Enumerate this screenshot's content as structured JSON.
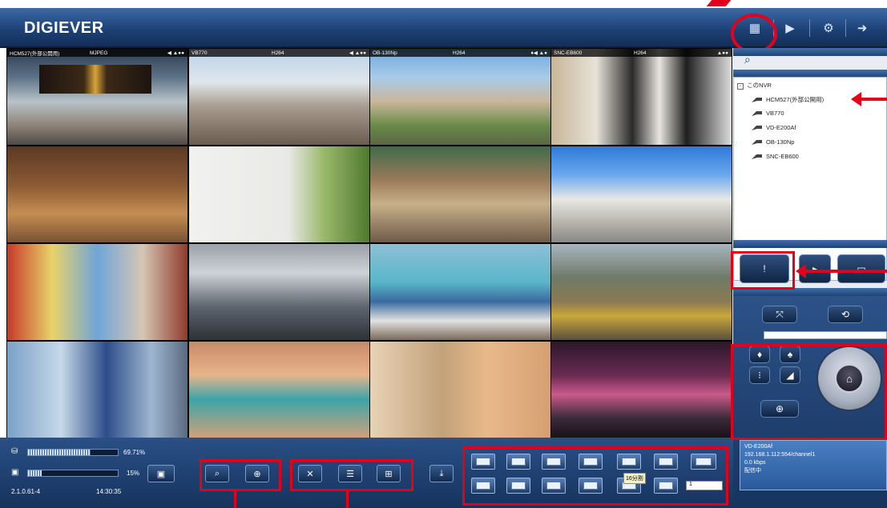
{
  "header": {
    "logo": "DIGIEVER",
    "icons": [
      "layout-icon",
      "playback-icon",
      "settings-icon",
      "logout-icon"
    ]
  },
  "cameras": [
    {
      "name": "HCM527(外部公開用)",
      "codec": "MJPEG",
      "icons": "◀ ▲●●"
    },
    {
      "name": "VB770",
      "codec": "H264",
      "icons": "◀ ▲●●"
    },
    {
      "name": "OB-130Np",
      "codec": "H264",
      "icons": "♦◀ ▲●"
    },
    {
      "name": "SNC-EB600",
      "codec": "H264",
      "icons": "▲●●"
    }
  ],
  "tree": {
    "root": "このNVR",
    "items": [
      "HCM527(外部公開用)",
      "VB770",
      "VD-E200Af",
      "OB-130Np",
      "SNC-EB600"
    ]
  },
  "status": {
    "device": "VD-E200Af",
    "url": "192.168.1.112:554/channel1",
    "bitrate": "0.0 kbps",
    "state": "配信中"
  },
  "bottom": {
    "disk_percent": "69.71%",
    "cpu_percent": "15%",
    "version": "2.1.0.61-4",
    "time": "14:30:35",
    "layout_tooltip": "16分割",
    "dropdown_value": "1"
  },
  "colors": {
    "header": "#1c3f73",
    "highlight": "#e3001b"
  }
}
